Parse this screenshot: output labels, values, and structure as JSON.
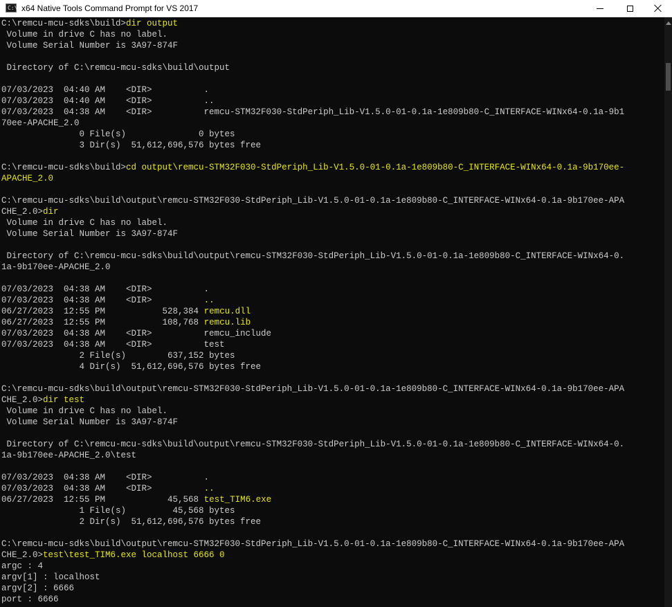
{
  "window": {
    "title": "x64 Native Tools Command Prompt for VS 2017",
    "icon_text": "C:\\"
  },
  "icons": {
    "app": "terminal-icon",
    "minimize": "minimize-icon",
    "maximize": "maximize-icon",
    "close": "close-icon"
  },
  "colors": {
    "background": "#0c0c0c",
    "text": "#cccccc",
    "command": "#e5e510"
  },
  "console": {
    "lines": [
      {
        "prompt": "C:\\remcu-mcu-sdks\\build>",
        "cmd": "dir output"
      },
      {
        "text": " Volume in drive C has no label."
      },
      {
        "text": " Volume Serial Number is 3A97-874F"
      },
      {
        "text": ""
      },
      {
        "text": " Directory of C:\\remcu-mcu-sdks\\build\\output"
      },
      {
        "text": ""
      },
      {
        "text": "07/03/2023  04:40 AM    <DIR>          ."
      },
      {
        "text": "07/03/2023  04:40 AM    <DIR>          .."
      },
      {
        "text": "07/03/2023  04:38 AM    <DIR>          remcu-STM32F030-StdPeriph_Lib-V1.5.0-01-0.1a-1e809b80-C_INTERFACE-WINx64-0.1a-9b1"
      },
      {
        "text": "70ee-APACHE_2.0"
      },
      {
        "text": "               0 File(s)              0 bytes"
      },
      {
        "text": "               3 Dir(s)  51,612,696,576 bytes free"
      },
      {
        "text": ""
      },
      {
        "prompt": "C:\\remcu-mcu-sdks\\build>",
        "cmd": "cd output\\remcu-STM32F030-StdPeriph_Lib-V1.5.0-01-0.1a-1e809b80-C_INTERFACE-WINx64-0.1a-9b170ee-"
      },
      {
        "prompt": "",
        "cmd": "APACHE_2.0"
      },
      {
        "text": ""
      },
      {
        "text": "C:\\remcu-mcu-sdks\\build\\output\\remcu-STM32F030-StdPeriph_Lib-V1.5.0-01-0.1a-1e809b80-C_INTERFACE-WINx64-0.1a-9b170ee-APA"
      },
      {
        "prompt": "CHE_2.0>",
        "cmd": "dir"
      },
      {
        "text": " Volume in drive C has no label."
      },
      {
        "text": " Volume Serial Number is 3A97-874F"
      },
      {
        "text": ""
      },
      {
        "text": " Directory of C:\\remcu-mcu-sdks\\build\\output\\remcu-STM32F030-StdPeriph_Lib-V1.5.0-01-0.1a-1e809b80-C_INTERFACE-WINx64-0."
      },
      {
        "text": "1a-9b170ee-APACHE_2.0"
      },
      {
        "text": ""
      },
      {
        "text": "07/03/2023  04:38 AM    <DIR>          ."
      },
      {
        "prompt": "07/03/2023  04:38 AM    <DIR>          ",
        "cmd": ".."
      },
      {
        "prompt": "06/27/2023  12:55 PM           528,384 ",
        "cmd": "remcu.dll"
      },
      {
        "prompt": "06/27/2023  12:55 PM           108,768 ",
        "cmd": "remcu.lib"
      },
      {
        "text": "07/03/2023  04:38 AM    <DIR>          remcu_include"
      },
      {
        "text": "07/03/2023  04:38 AM    <DIR>          test"
      },
      {
        "text": "               2 File(s)        637,152 bytes"
      },
      {
        "text": "               4 Dir(s)  51,612,696,576 bytes free"
      },
      {
        "text": ""
      },
      {
        "text": "C:\\remcu-mcu-sdks\\build\\output\\remcu-STM32F030-StdPeriph_Lib-V1.5.0-01-0.1a-1e809b80-C_INTERFACE-WINx64-0.1a-9b170ee-APA"
      },
      {
        "prompt": "CHE_2.0>",
        "cmd": "dir test"
      },
      {
        "text": " Volume in drive C has no label."
      },
      {
        "text": " Volume Serial Number is 3A97-874F"
      },
      {
        "text": ""
      },
      {
        "text": " Directory of C:\\remcu-mcu-sdks\\build\\output\\remcu-STM32F030-StdPeriph_Lib-V1.5.0-01-0.1a-1e809b80-C_INTERFACE-WINx64-0."
      },
      {
        "text": "1a-9b170ee-APACHE_2.0\\test"
      },
      {
        "text": ""
      },
      {
        "text": "07/03/2023  04:38 AM    <DIR>          ."
      },
      {
        "prompt": "07/03/2023  04:38 AM    <DIR>          ",
        "cmd": ".."
      },
      {
        "prompt": "06/27/2023  12:55 PM            45,568 ",
        "cmd": "test_TIM6.exe"
      },
      {
        "text": "               1 File(s)         45,568 bytes"
      },
      {
        "text": "               2 Dir(s)  51,612,696,576 bytes free"
      },
      {
        "text": ""
      },
      {
        "text": "C:\\remcu-mcu-sdks\\build\\output\\remcu-STM32F030-StdPeriph_Lib-V1.5.0-01-0.1a-1e809b80-C_INTERFACE-WINx64-0.1a-9b170ee-APA"
      },
      {
        "prompt": "CHE_2.0>",
        "cmd": "test\\test_TIM6.exe localhost 6666 0"
      },
      {
        "text": "argc : 4"
      },
      {
        "text": "argv[1] : localhost"
      },
      {
        "text": "argv[2] : 6666"
      },
      {
        "text": "port : 6666"
      }
    ]
  }
}
